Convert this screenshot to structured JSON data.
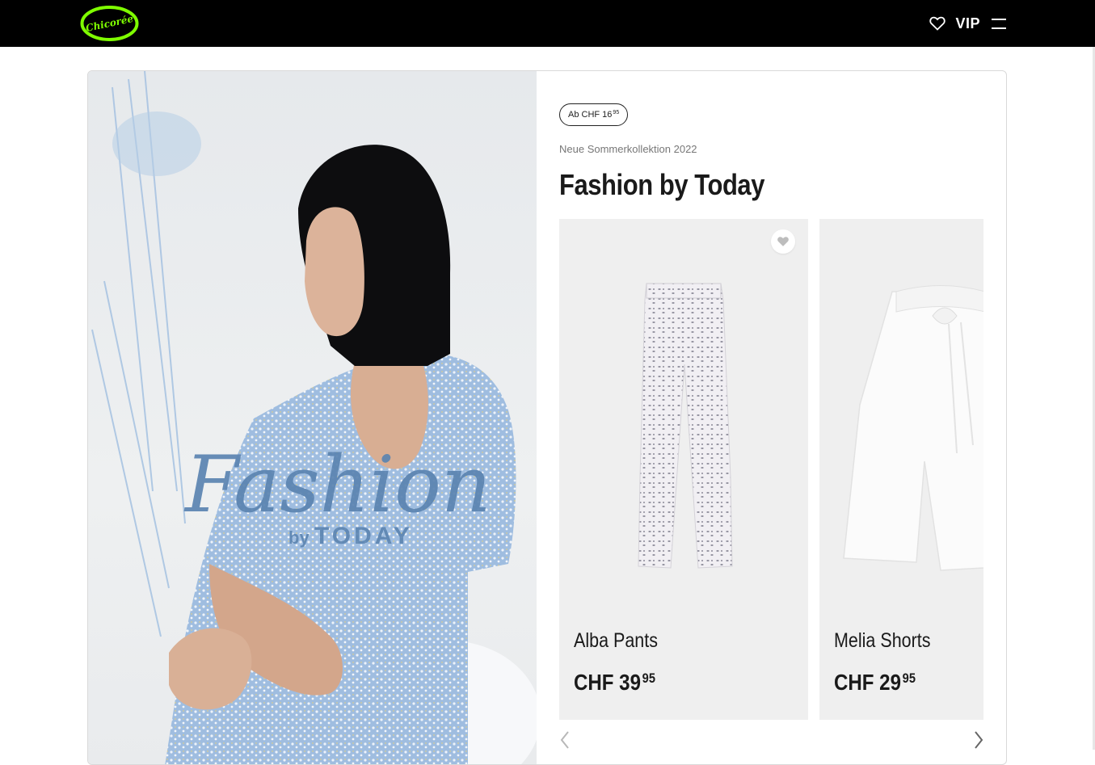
{
  "header": {
    "logo_text": "Chicorée",
    "vip_label": "VIP",
    "icons": [
      "heart-icon",
      "menu-icon"
    ],
    "logo_color": "#7fff00"
  },
  "teaser": {
    "price_pill": {
      "prefix": "Ab CHF 16",
      "cents": "95"
    },
    "subtitle": "Neue Sommerkollektion 2022",
    "title": "Fashion by Today",
    "hero_overlay": {
      "script": "Fashion",
      "by": "by",
      "brand": "TODAY"
    }
  },
  "products": [
    {
      "name": "Alba Pants",
      "price_main": "CHF 39",
      "price_cents": "95"
    },
    {
      "name": "Melia Shorts",
      "price_main": "CHF 29",
      "price_cents": "95"
    }
  ],
  "colors": {
    "accent": "#7fff00",
    "hero_text": "#5b84b1",
    "card_bg": "#efefef"
  }
}
